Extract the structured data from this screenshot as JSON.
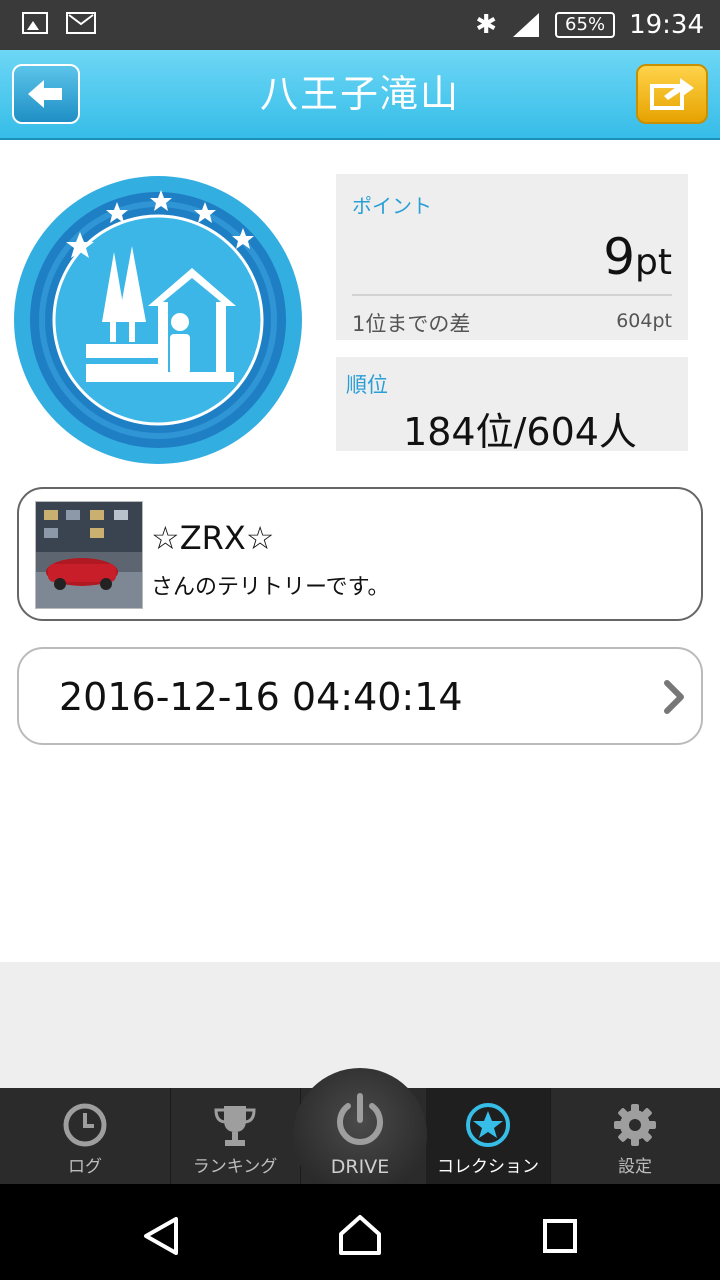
{
  "status_bar": {
    "battery": "65%",
    "time": "19:34"
  },
  "header": {
    "title": "八王子滝山"
  },
  "points": {
    "label": "ポイント",
    "value": "9",
    "unit": "pt",
    "gap_label": "1位までの差",
    "gap_value": "604pt"
  },
  "rank": {
    "label": "順位",
    "value": "184位/604人"
  },
  "owner": {
    "name": "☆ZRX☆",
    "subtitle": "さんのテリトリーです。"
  },
  "history": {
    "datetime": "2016-12-16 04:40:14"
  },
  "tabs": [
    {
      "label": "ログ",
      "icon": "clock-icon"
    },
    {
      "label": "ランキング",
      "icon": "trophy-icon"
    },
    {
      "label": "DRIVE",
      "icon": "power-icon"
    },
    {
      "label": "コレクション",
      "icon": "star-icon"
    },
    {
      "label": "設定",
      "icon": "gear-icon"
    }
  ],
  "colors": {
    "accent": "#36bde8",
    "label_blue": "#2a9fd6",
    "share": "#f2b800"
  }
}
